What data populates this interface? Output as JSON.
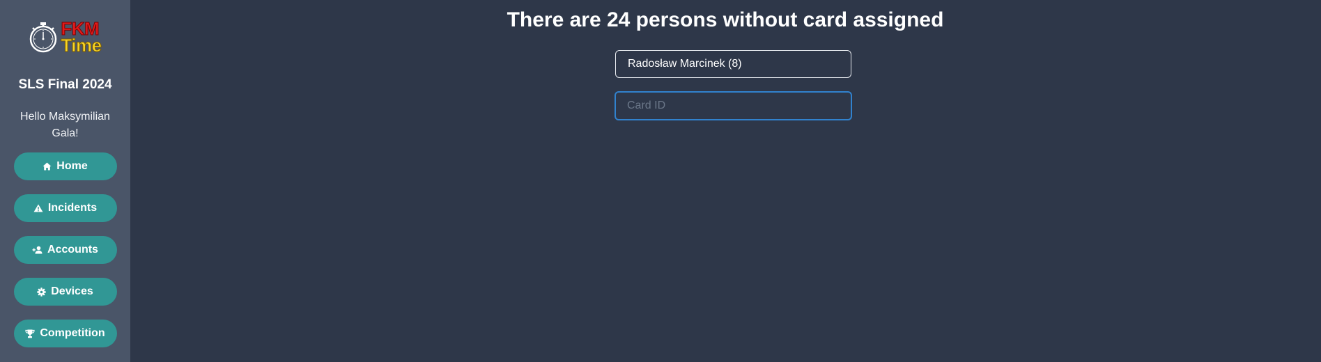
{
  "logo": {
    "line1": "FKM",
    "line2": "Time"
  },
  "sidebar": {
    "event_name": "SLS Final 2024",
    "greeting": "Hello Maksymilian Gala!",
    "items": [
      {
        "label": "Home",
        "icon": "home-icon"
      },
      {
        "label": "Incidents",
        "icon": "warning-icon"
      },
      {
        "label": "Accounts",
        "icon": "add-user-icon"
      },
      {
        "label": "Devices",
        "icon": "gear-icon"
      },
      {
        "label": "Competition",
        "icon": "trophy-icon"
      }
    ]
  },
  "main": {
    "title": "There are 24 persons without card assigned",
    "person_select": {
      "value": "Radosław Marcinek (8)"
    },
    "card_input": {
      "placeholder": "Card ID",
      "value": ""
    }
  },
  "colors": {
    "background": "#2e3749",
    "sidebar": "#4a5568",
    "accent": "#319795",
    "focus": "#3182ce"
  }
}
